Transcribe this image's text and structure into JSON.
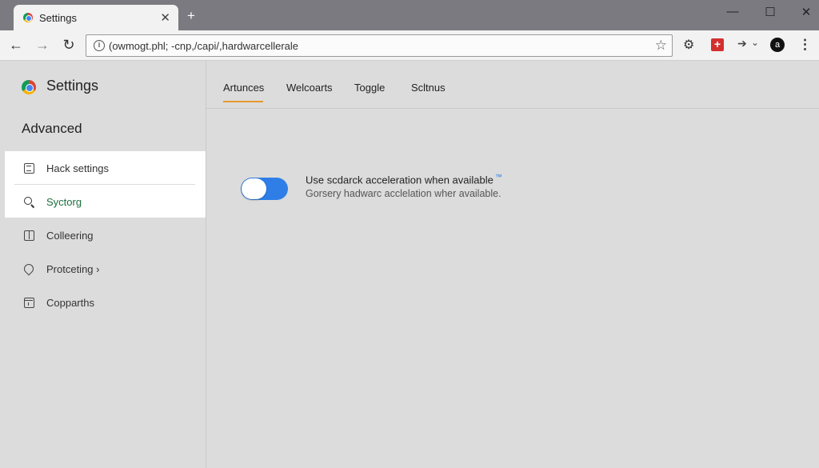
{
  "browser": {
    "tab_title": "Settings",
    "tab_close": "✕",
    "new_tab": "+",
    "window_controls": {
      "minimize": "—",
      "maximize": "☐",
      "close": "✕"
    },
    "url": "(owmogt.phl; -cnp,/capi/,hardwarcellerale",
    "back": "←",
    "forward": "→",
    "reload": "↻",
    "bookmark": "☆",
    "extension_gear": "⚙",
    "extension_red": "+",
    "extension_arrow": "➔",
    "extension_arrow_caret": "⌄",
    "profile": "a",
    "menu": "⋮"
  },
  "sidebar": {
    "title": "Settings",
    "section": "Advanced",
    "items": [
      {
        "label": "Hack settings",
        "icon": "list-box-icon"
      },
      {
        "label": "Syctorg",
        "icon": "search-icon",
        "active": true
      },
      {
        "label": "Colleering",
        "icon": "grid-box-icon"
      },
      {
        "label": "Protceting ›",
        "icon": "speech-bubble-icon"
      },
      {
        "label": "Copparths",
        "icon": "calendar-box-icon"
      }
    ]
  },
  "main": {
    "tabs": [
      {
        "label": "Artunces",
        "selected": true
      },
      {
        "label": "Welcoarts"
      },
      {
        "label": "Toggle"
      },
      {
        "label": "Scltnus"
      }
    ],
    "setting": {
      "title": "Use scdarck acceleration when available",
      "trademark": "™",
      "description": "Gorsery hadwarc acclelation wher available.",
      "enabled": true
    }
  },
  "colors": {
    "accent_blue": "#2f7ee8",
    "tab_underline": "#e39a2d",
    "active_item_text": "#1e6e3e",
    "extension_red": "#d32f2f"
  }
}
